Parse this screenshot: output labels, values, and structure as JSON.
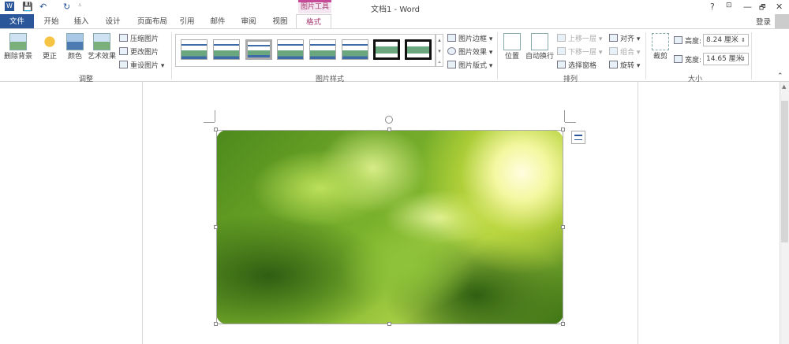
{
  "title": {
    "doc": "文档1 - Word",
    "context_tab": "图片工具",
    "help": "?",
    "ribbon_opts": "⊡",
    "minimize": "—",
    "restore": "🗗",
    "close": "✕",
    "login": "登录"
  },
  "quick_access": {
    "save": "💾",
    "undo": "↶",
    "redo": "↻",
    "customize": "⩡"
  },
  "tabs": [
    "文件",
    "开始",
    "插入",
    "设计",
    "页面布局",
    "引用",
    "邮件",
    "审阅",
    "视图",
    "格式"
  ],
  "ribbon": {
    "adjust": {
      "label": "调整",
      "remove_bg": "删除背景",
      "corrections": "更正",
      "color": "颜色",
      "artistic": "艺术效果",
      "compress": "压缩图片",
      "change": "更改图片",
      "reset": "重设图片"
    },
    "styles": {
      "label": "图片样式",
      "border": "图片边框",
      "effects": "图片效果",
      "layout": "图片版式"
    },
    "arrange": {
      "label": "排列",
      "position": "位置",
      "wrap": "自动换行",
      "forward": "上移一层",
      "backward": "下移一层",
      "pane": "选择窗格",
      "align": "对齐",
      "group": "组合",
      "rotate": "旋转"
    },
    "size": {
      "label": "大小",
      "crop": "裁剪",
      "height_label": "高度:",
      "height": "8.24 厘米",
      "width_label": "宽度:",
      "width": "14.65 厘米"
    }
  }
}
